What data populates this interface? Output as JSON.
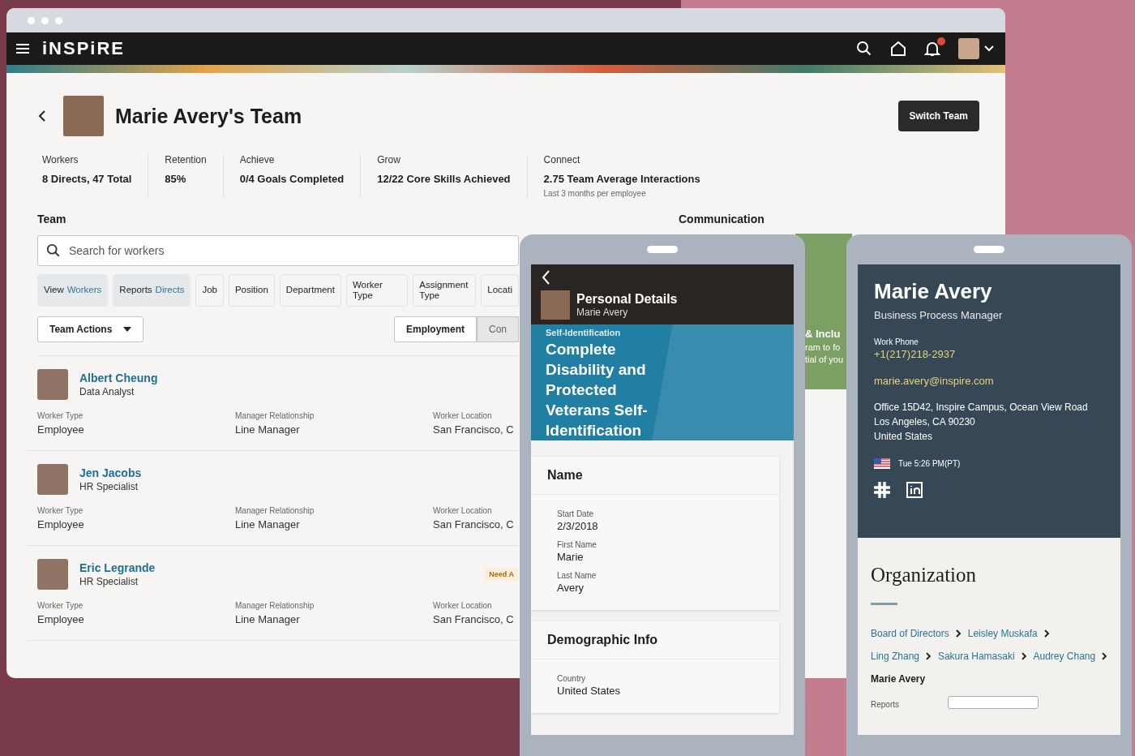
{
  "app": {
    "logo": "iNSPiRE"
  },
  "header": {
    "title": "Marie Avery's Team",
    "action": "Switch Team"
  },
  "metrics": [
    {
      "label": "Workers",
      "value": "8 Directs, 47 Total"
    },
    {
      "label": "Retention",
      "value": "85%"
    },
    {
      "label": "Achieve",
      "value": "0/4 Goals Completed"
    },
    {
      "label": "Grow",
      "value": "12/22 Core Skills Achieved"
    },
    {
      "label": "Connect",
      "value": "2.75 Team Average Interactions",
      "note": "Last 3 months per employee"
    }
  ],
  "team": {
    "heading": "Team",
    "search": {
      "placeholder": "Search for workers"
    },
    "filters": [
      {
        "label": "View",
        "accent": "Workers",
        "selected": true
      },
      {
        "label": "Reports",
        "accent": "Directs",
        "selected": true
      },
      {
        "label": "Job",
        "selected": false
      },
      {
        "label": "Position",
        "selected": false
      },
      {
        "label": "Department",
        "selected": false
      },
      {
        "label": "Worker Type",
        "selected": false
      },
      {
        "label": "Assignment Type",
        "selected": false
      },
      {
        "label": "Locati",
        "selected": false
      }
    ],
    "actions": "Team Actions",
    "views": [
      {
        "label": "Employment",
        "selected": true
      },
      {
        "label": "Con",
        "selected": false
      }
    ],
    "workers": [
      {
        "name": "Albert Cheung",
        "role": "Data Analyst",
        "fields": [
          {
            "label": "Worker Type",
            "value": "Employee"
          },
          {
            "label": "Manager Relationship",
            "value": "Line Manager"
          },
          {
            "label": "Worker Location",
            "value": "San Francisco, C"
          }
        ]
      },
      {
        "name": "Jen Jacobs",
        "role": "HR Specialist",
        "fields": [
          {
            "label": "Worker Type",
            "value": "Employee"
          },
          {
            "label": "Manager Relationship",
            "value": "Line Manager"
          },
          {
            "label": "Worker Location",
            "value": "San Francisco, C"
          }
        ]
      },
      {
        "name": "Eric Legrande",
        "role": "HR Specialist",
        "badge": "Need A",
        "fields": [
          {
            "label": "Worker Type",
            "value": "Employee"
          },
          {
            "label": "Manager Relationship",
            "value": "Line Manager"
          },
          {
            "label": "Worker Location",
            "value": "San Francisco, C"
          }
        ]
      }
    ]
  },
  "communication": {
    "heading": "Communication",
    "card_title": "& Inclu",
    "card_lines": [
      "ram to fo",
      "tial of you"
    ]
  },
  "personal_details": {
    "title": "Personal Details",
    "subtitle": "Marie Avery",
    "banner": {
      "eyebrow": "Self-Identification",
      "title": "Complete Disability and Protected Veterans Self-Identification"
    },
    "sections": [
      {
        "title": "Name",
        "fields": [
          {
            "label": "Start Date",
            "value": "2/3/2018"
          },
          {
            "label": "First Name",
            "value": "Marie"
          },
          {
            "label": "Last Name",
            "value": "Avery"
          }
        ]
      },
      {
        "title": "Demographic Info",
        "fields": [
          {
            "label": "Country",
            "value": "United States"
          }
        ]
      }
    ]
  },
  "profile": {
    "name": "Marie Avery",
    "title": "Business Process Manager",
    "phone_label": "Work Phone",
    "phone": "+1(217)218-2937",
    "email": "marie.avery@inspire.com",
    "address": [
      "Office 15D42, Inspire Campus, Ocean View Road",
      "Los Angeles, CA 90230",
      "United States"
    ],
    "local_time": "Tue 5:26 PM(PT)"
  },
  "organization": {
    "heading": "Organization",
    "path": [
      {
        "links": [
          "Board of Directors",
          "Leisley Muskafa"
        ]
      },
      {
        "links": [
          "Ling Zhang",
          "Sakura Hamasaki",
          "Audrey Chang"
        ]
      }
    ],
    "current": "Marie Avery",
    "reports_label": "Reports"
  }
}
